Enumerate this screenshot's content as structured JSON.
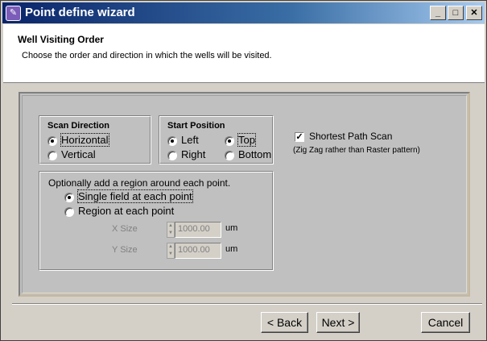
{
  "window": {
    "title": "Point define wizard",
    "icon": "wizard-app-icon"
  },
  "titlebar_buttons": {
    "minimize": "_",
    "maximize": "□",
    "close": "✕"
  },
  "header": {
    "title": "Well Visiting Order",
    "subtitle": "Choose the order and direction in which the wells will be visited."
  },
  "scan_direction": {
    "label": "Scan Direction",
    "options": [
      {
        "label": "Horizontal",
        "selected": true
      },
      {
        "label": "Vertical",
        "selected": false
      }
    ]
  },
  "start_position": {
    "label": "Start Position",
    "horizontal": [
      {
        "label": "Left",
        "selected": true
      },
      {
        "label": "Right",
        "selected": false
      }
    ],
    "vertical": [
      {
        "label": "Top",
        "selected": true
      },
      {
        "label": "Bottom",
        "selected": false
      }
    ]
  },
  "shortest_path": {
    "label": "Shortest Path Scan",
    "checked": true,
    "note": "(Zig Zag rather than Raster pattern)"
  },
  "region": {
    "label": "Optionally add a region around each point.",
    "options": [
      {
        "label": "Single field at each point",
        "selected": true
      },
      {
        "label": "Region at each point",
        "selected": false
      }
    ],
    "x_size": {
      "label": "X Size",
      "value": "1000.00",
      "unit": "um"
    },
    "y_size": {
      "label": "Y Size",
      "value": "1000.00",
      "unit": "um"
    }
  },
  "buttons": {
    "back": "< Back",
    "next": "Next >",
    "cancel": "Cancel"
  }
}
